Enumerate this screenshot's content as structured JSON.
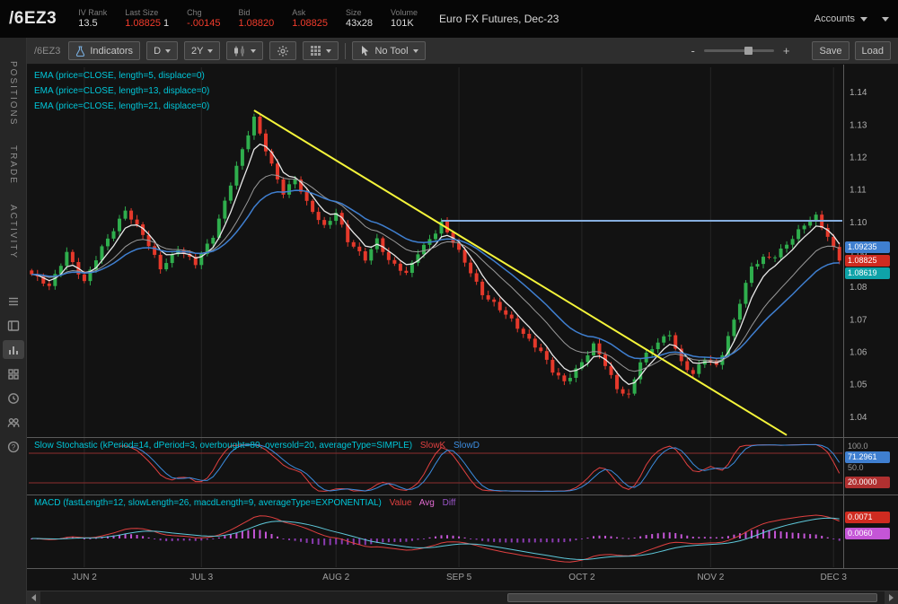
{
  "top_bar": {
    "symbol": "/6EZ3",
    "fields": [
      {
        "label": "IV Rank",
        "value": "13.5"
      },
      {
        "label": "Last Size",
        "value": "1.08825",
        "extra": "1"
      },
      {
        "label": "Chg",
        "value": "-.00145"
      },
      {
        "label": "Bid",
        "value": "1.08820"
      },
      {
        "label": "Ask",
        "value": "1.08825"
      },
      {
        "label": "Size",
        "value": "43x28"
      },
      {
        "label": "Volume",
        "value": "101K"
      }
    ],
    "description": "Euro FX Futures, Dec-23",
    "accounts_label": "Accounts"
  },
  "sidebar": {
    "tabs": [
      {
        "label": "POSITIONS"
      },
      {
        "label": "TRADE"
      },
      {
        "label": "ACTIVITY"
      }
    ],
    "help_glyph": "?"
  },
  "toolbar": {
    "symbol_label": "/6EZ3",
    "indicators_label": "Indicators",
    "timeframe_value": "D",
    "range_value": "2Y",
    "tool_value": "No Tool",
    "zoom_out_label": "-",
    "zoom_in_label": "+",
    "save_label": "Save",
    "load_label": "Load"
  },
  "chart_data": {
    "type": "candlestick",
    "title": "Euro FX Futures, Dec-23",
    "ema_labels": [
      "EMA (price=CLOSE, length=5, displace=0)",
      "EMA (price=CLOSE, length=13, displace=0)",
      "EMA (price=CLOSE, length=21, displace=0)"
    ],
    "colors": {
      "up": "#2fae4d",
      "down": "#e5392b",
      "ema5": "#e8e8e8",
      "ema13": "#9a9a9a",
      "ema21": "#3f7fd0",
      "trendline": "#f5f53a",
      "hline": "#86aede",
      "stoch_k": "#e04040",
      "stoch_d": "#3c8de0",
      "macd_value": "#e04040",
      "macd_avg": "#5ec8da",
      "macd_diff_pos": "#c455d6",
      "macd_diff_neg": "#8a3bb0"
    },
    "y_axis": {
      "min": 1.035,
      "max": 1.145,
      "ticks": [
        1.14,
        1.13,
        1.12,
        1.11,
        1.1,
        1.09,
        1.08,
        1.07,
        1.06,
        1.05,
        1.04
      ]
    },
    "x_axis": {
      "labels": [
        "JUN 2",
        "JUL 3",
        "AUG 2",
        "SEP 5",
        "OCT 2",
        "NOV 2",
        "DEC 3"
      ],
      "indices": [
        9,
        29,
        52,
        73,
        94,
        116,
        137
      ]
    },
    "candle_count": 139,
    "last_close": 1.08825,
    "close_waypoints": [
      [
        0,
        1.084
      ],
      [
        3,
        1.08
      ],
      [
        6,
        1.091
      ],
      [
        9,
        1.0815
      ],
      [
        12,
        1.092
      ],
      [
        16,
        1.104
      ],
      [
        19,
        1.096
      ],
      [
        22,
        1.086
      ],
      [
        25,
        1.092
      ],
      [
        28,
        1.087
      ],
      [
        31,
        1.096
      ],
      [
        34,
        1.112
      ],
      [
        37,
        1.127
      ],
      [
        38,
        1.132
      ],
      [
        41,
        1.118
      ],
      [
        43,
        1.109
      ],
      [
        45,
        1.113
      ],
      [
        47,
        1.106
      ],
      [
        50,
        1.099
      ],
      [
        52,
        1.103
      ],
      [
        54,
        1.094
      ],
      [
        57,
        1.089
      ],
      [
        59,
        1.095
      ],
      [
        61,
        1.088
      ],
      [
        64,
        1.084
      ],
      [
        66,
        1.091
      ],
      [
        69,
        1.097
      ],
      [
        70,
        1.0995
      ],
      [
        73,
        1.091
      ],
      [
        75,
        1.085
      ],
      [
        77,
        1.078
      ],
      [
        80,
        1.073
      ],
      [
        82,
        1.07
      ],
      [
        84,
        1.066
      ],
      [
        87,
        1.06
      ],
      [
        89,
        1.054
      ],
      [
        91,
        1.051
      ],
      [
        94,
        1.057
      ],
      [
        96,
        1.062
      ],
      [
        98,
        1.056
      ],
      [
        100,
        1.049
      ],
      [
        102,
        1.047
      ],
      [
        104,
        1.057
      ],
      [
        107,
        1.063
      ],
      [
        109,
        1.066
      ],
      [
        111,
        1.057
      ],
      [
        113,
        1.053
      ],
      [
        115,
        1.058
      ],
      [
        117,
        1.056
      ],
      [
        118,
        1.06
      ],
      [
        120,
        1.07
      ],
      [
        123,
        1.086
      ],
      [
        125,
        1.089
      ],
      [
        127,
        1.09
      ],
      [
        130,
        1.095
      ],
      [
        132,
        1.099
      ],
      [
        134,
        1.102
      ],
      [
        136,
        1.096
      ],
      [
        138,
        1.08825
      ]
    ],
    "trendline": {
      "from_index": 38,
      "from_price": 1.1345,
      "to_index": 129,
      "to_price": 1.0345
    },
    "horizontal_line": {
      "price": 1.1005,
      "from_index": 70
    },
    "price_badges": [
      {
        "value": "1.09235",
        "color": "#3f7fd0"
      },
      {
        "value": "1.08825",
        "color": "#cf2b20"
      },
      {
        "value": "1.08619",
        "color": "#0fa3a8"
      }
    ],
    "stochastic": {
      "label": "Slow Stochastic (kPeriod=14, dPeriod=3, overbought=80, oversold=20, averageType=SIMPLE)",
      "k_label": "SlowK",
      "d_label": "SlowD",
      "k_period": 14,
      "d_period": 3,
      "overbought": 80,
      "oversold": 20,
      "axis_top": "100.0",
      "axis_mid": "50.0",
      "k_badge": {
        "value": "71.2961",
        "color": "#3f7fd0"
      },
      "oversold_badge": {
        "value": "20.0000",
        "color": "#b03030"
      }
    },
    "macd": {
      "label": "MACD (fastLength=12, slowLength=26, macdLength=9, averageType=EXPONENTIAL)",
      "legend": [
        {
          "label": "Value",
          "color": "#e04040"
        },
        {
          "label": "Avg",
          "color": "#e06ad0"
        },
        {
          "label": "Diff",
          "color": "#9a55c8"
        }
      ],
      "fast": 12,
      "slow": 26,
      "signal": 9,
      "value_badge": {
        "value": "0.0071",
        "color": "#cf2b20"
      },
      "avg_badge": {
        "value": "0.0060",
        "color": "#c455d6"
      }
    }
  }
}
